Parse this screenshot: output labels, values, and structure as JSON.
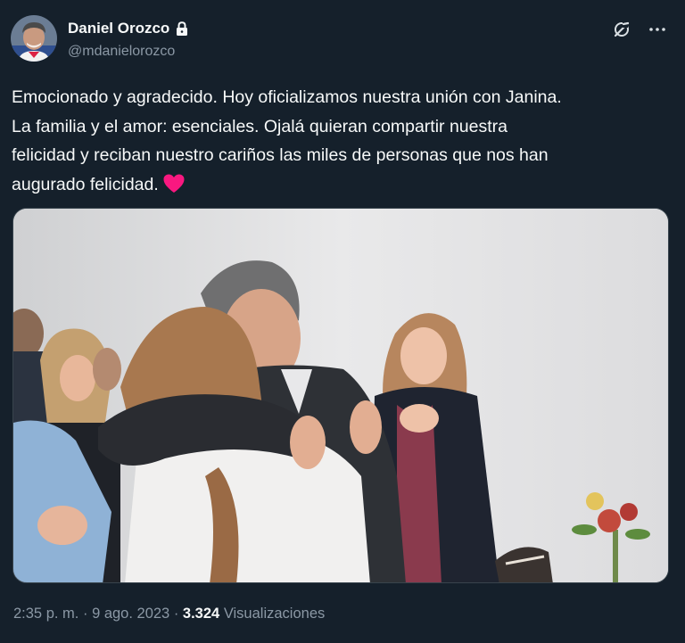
{
  "author": {
    "display_name": "Daniel Orozco",
    "handle": "@mdanielorozco",
    "protected_icon": "lock-icon",
    "avatar_icon": "avatar"
  },
  "header_actions": {
    "grok_icon": "grok-icon",
    "more_icon": "more-icon"
  },
  "tweet": {
    "lines": [
      "Emocionado y agradecido. Hoy oficializamos nuestra unión con Janina.",
      "La familia y el amor:  esenciales. Ojalá quieran compartir nuestra",
      "felicidad y reciban nuestro cariños las miles de personas que nos han",
      "augurado felicidad."
    ],
    "emoji": "heart-icon",
    "heart_color": "#f91880"
  },
  "meta": {
    "time": "2:35 p. m.",
    "separator": "·",
    "date": "9 ago. 2023",
    "views_count": "3.324",
    "views_label": "Visualizaciones"
  },
  "colors": {
    "background": "#15202b",
    "text_primary": "#f7f9f9",
    "text_secondary": "#8b98a5",
    "border": "#38444d"
  }
}
